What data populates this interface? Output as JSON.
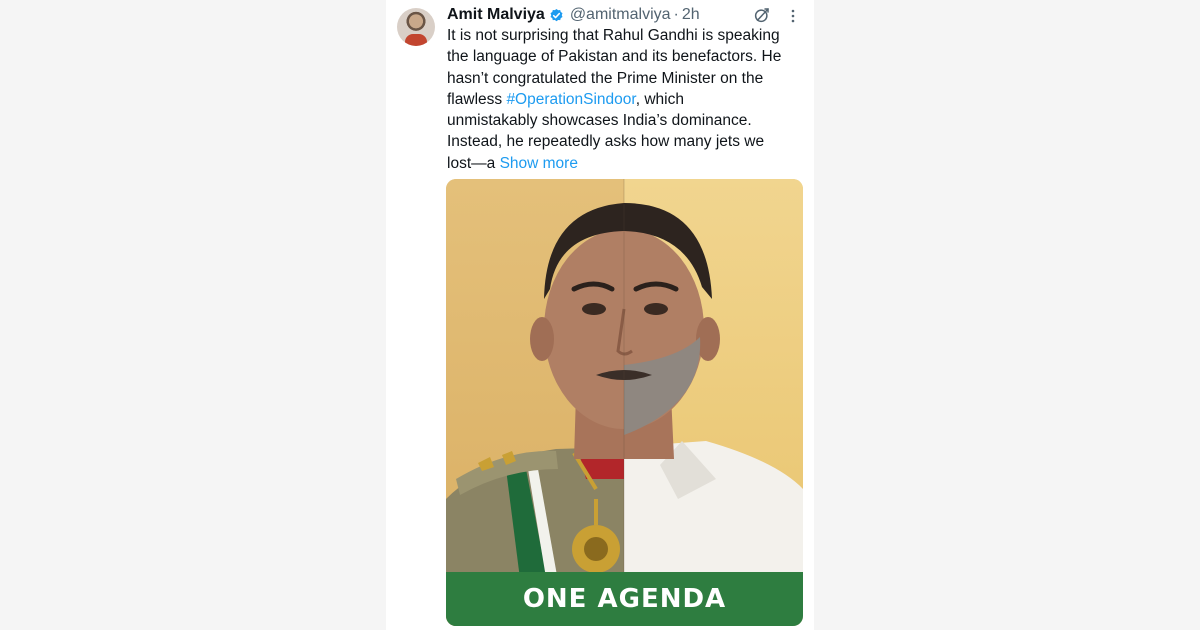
{
  "tweet": {
    "author": {
      "display_name": "Amit Malviya",
      "handle": "@amitmalviya",
      "separator": "·",
      "time": "2h",
      "verified": true,
      "avatar_icon": "avatar-photo"
    },
    "header_icons": {
      "grok": "grok-icon",
      "more": "more-options-icon"
    },
    "text_lines": [
      "It is not surprising that Rahul Gandhi is speaking",
      "the language of Pakistan and its benefactors. He",
      "hasn’t congratulated the Prime Minister on the",
      "flawless ",
      "unmistakably showcases India’s dominance.",
      "Instead, he repeatedly asks how many jets we",
      "lost—a "
    ],
    "hashtag": "#OperationSindoor",
    "after_hashtag": ", which",
    "show_more_label": "Show more",
    "media": {
      "banner_text": "ONE AGENDA",
      "description_icon": "split-portrait-image"
    }
  },
  "colors": {
    "link": "#1d9bf0",
    "text": "#0f1419",
    "secondary_text": "#536471",
    "banner": "#2e7d40",
    "page_background": "#f5f5f5"
  }
}
